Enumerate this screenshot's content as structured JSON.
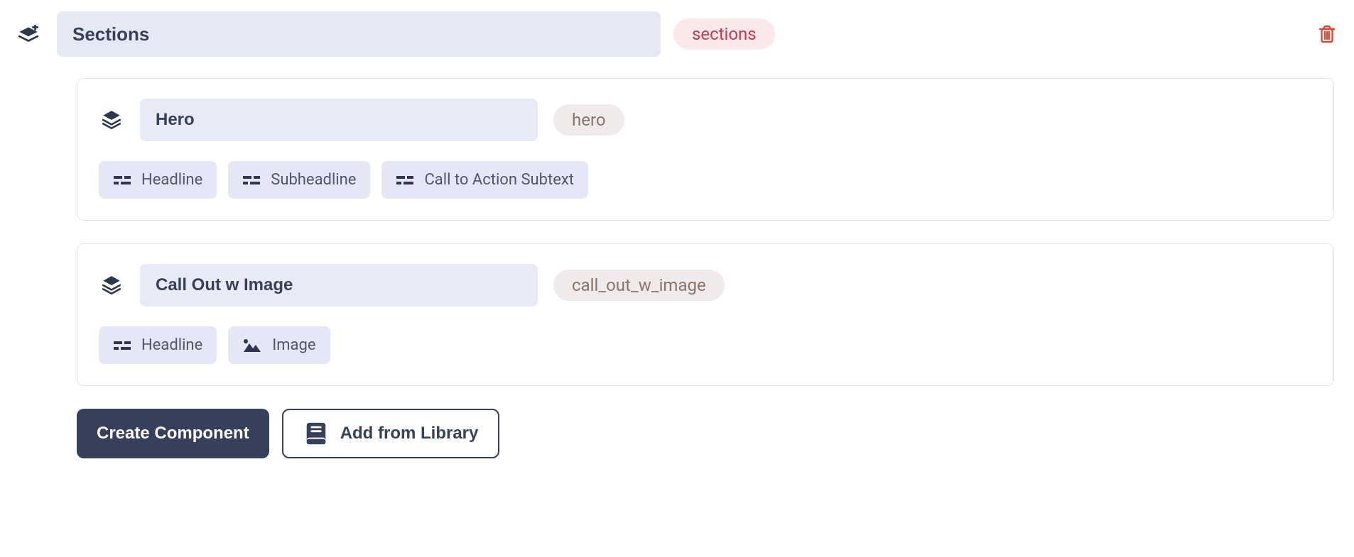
{
  "section": {
    "name": "Sections",
    "slug": "sections"
  },
  "components": [
    {
      "name": "Hero",
      "slug": "hero",
      "fields": [
        {
          "type": "text",
          "label": "Headline"
        },
        {
          "type": "text",
          "label": "Subheadline"
        },
        {
          "type": "text",
          "label": "Call to Action Subtext"
        }
      ]
    },
    {
      "name": "Call Out w Image",
      "slug": "call_out_w_image",
      "fields": [
        {
          "type": "text",
          "label": "Headline"
        },
        {
          "type": "image",
          "label": "Image"
        }
      ]
    }
  ],
  "buttons": {
    "create_component": "Create Component",
    "add_from_library": "Add from Library"
  }
}
